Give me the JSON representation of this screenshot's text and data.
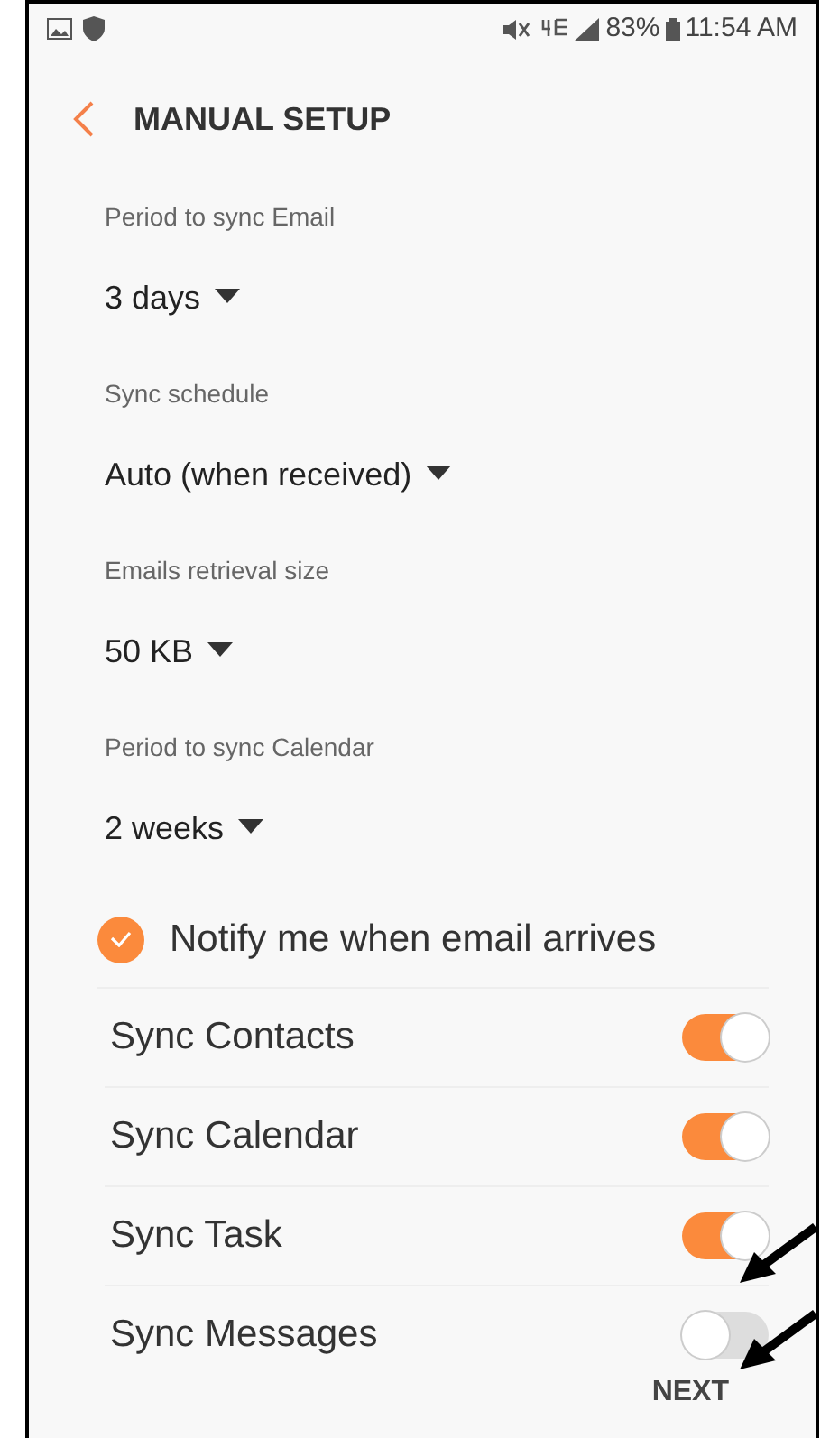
{
  "status_bar": {
    "time": "11:54 AM",
    "battery": "83%"
  },
  "header": {
    "title": "MANUAL SETUP"
  },
  "dropdowns": [
    {
      "label": "Period to sync Email",
      "value": "3 days"
    },
    {
      "label": "Sync schedule",
      "value": "Auto (when received)"
    },
    {
      "label": "Emails retrieval size",
      "value": "50 KB"
    },
    {
      "label": "Period to sync Calendar",
      "value": "2 weeks"
    }
  ],
  "notify": {
    "label": "Notify me when email arrives",
    "checked": true
  },
  "toggles": [
    {
      "label": "Sync Contacts",
      "on": true
    },
    {
      "label": "Sync Calendar",
      "on": true
    },
    {
      "label": "Sync Task",
      "on": true
    },
    {
      "label": "Sync Messages",
      "on": false
    }
  ],
  "footer": {
    "next": "NEXT"
  }
}
